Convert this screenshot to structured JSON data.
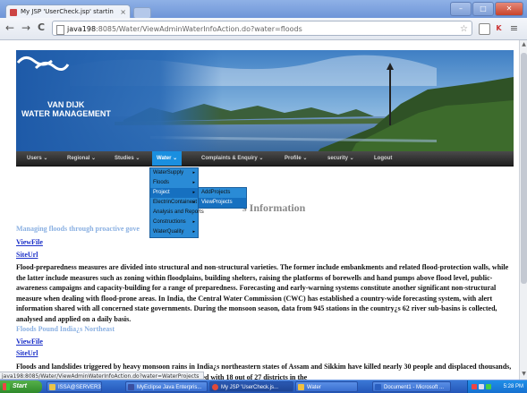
{
  "browser": {
    "tab_title": "My JSP 'UserCheck.jsp' startin",
    "tab_close": "×",
    "url_host": "java198",
    "url_path": ":8085/Water/ViewAdminWaterInfoAction.do?water=floods",
    "back": "←",
    "forward": "→",
    "reload": "C",
    "bookmark_star": "☆",
    "menu_icon": "≡",
    "status_url": "java198:8085/Water/ViewAdminWaterInfoAction.do?water=WaterProjects",
    "window_buttons": {
      "minimize": "–",
      "maximize": "□",
      "close": "✕"
    }
  },
  "site": {
    "logo_line1": "VAN DIJK",
    "logo_line2": "WATER MANAGEMENT",
    "menu": [
      "Users ⌄",
      "Regional ⌄",
      "Studies ⌄",
      "Water ⌄",
      "Complaints & Enquiry ⌄",
      "Profile ⌄",
      "security ⌄",
      "Logout"
    ],
    "water_submenu": [
      {
        "label": "WaterSupply",
        "has_arrow": true
      },
      {
        "label": "Floods",
        "has_arrow": true
      },
      {
        "label": "Project",
        "has_arrow": true
      },
      {
        "label": "ElectrinContainent",
        "has_arrow": true
      },
      {
        "label": "Analysis and Reports",
        "has_arrow": false
      },
      {
        "label": "Constructions",
        "has_arrow": true
      },
      {
        "label": "WaterQuality",
        "has_arrow": true
      }
    ],
    "project_submenu": [
      "AddProjects",
      "ViewProjects"
    ],
    "heading": "s Information",
    "arrow_glyph": "▸"
  },
  "items": [
    {
      "title": "Managing floods through proactive gove",
      "view_file": "ViewFile",
      "site_url": "SiteUrl",
      "text": "Flood-preparedness measures are divided into structural and non-structural varieties. The former include embankments and related flood-protection walls, while the latter include measures such as zoning within floodplains, building shelters, raising the platforms of borewells and hand pumps above flood level, public-awareness campaigns and capacity-building for a range of preparedness. Forecasting and early-warning systems constitute another significant non-structural measure when dealing with flood-prone areas. In India, the Central Water Commission (CWC) has established a country-wide forecasting system, with alert information shared with all concerned state governments. During the monsoon season, data from 945 stations in the country¿s 62 river sub-basins is collected, analysed and applied on a daily basis."
    },
    {
      "title": "Floods Pound India¿s Northeast",
      "view_file": "ViewFile",
      "site_url": "SiteUrl",
      "text": "Floods and landslides triggered by heavy monsoon rains in India¿s northeastern states of Assam and Sikkim have killed nearly 30 people and displaced thousands, according to state government officials. The situation worsened with 18 out of 27 districts in the"
    }
  ],
  "taskbar": {
    "start": "Start",
    "tasks": [
      "ISSA@SERVER3",
      "MyEclipse Java Enterpris...",
      "My JSP 'UserCheck.js...",
      "Water",
      "Document1 - Microsoft ..."
    ],
    "clock": "5:28 PM"
  },
  "colors": {
    "menu_active": "#1a8fe0",
    "dropdown_bg": "#2a8bd6",
    "item_title": "#8ab0e2",
    "link": "#1a2fc8"
  }
}
